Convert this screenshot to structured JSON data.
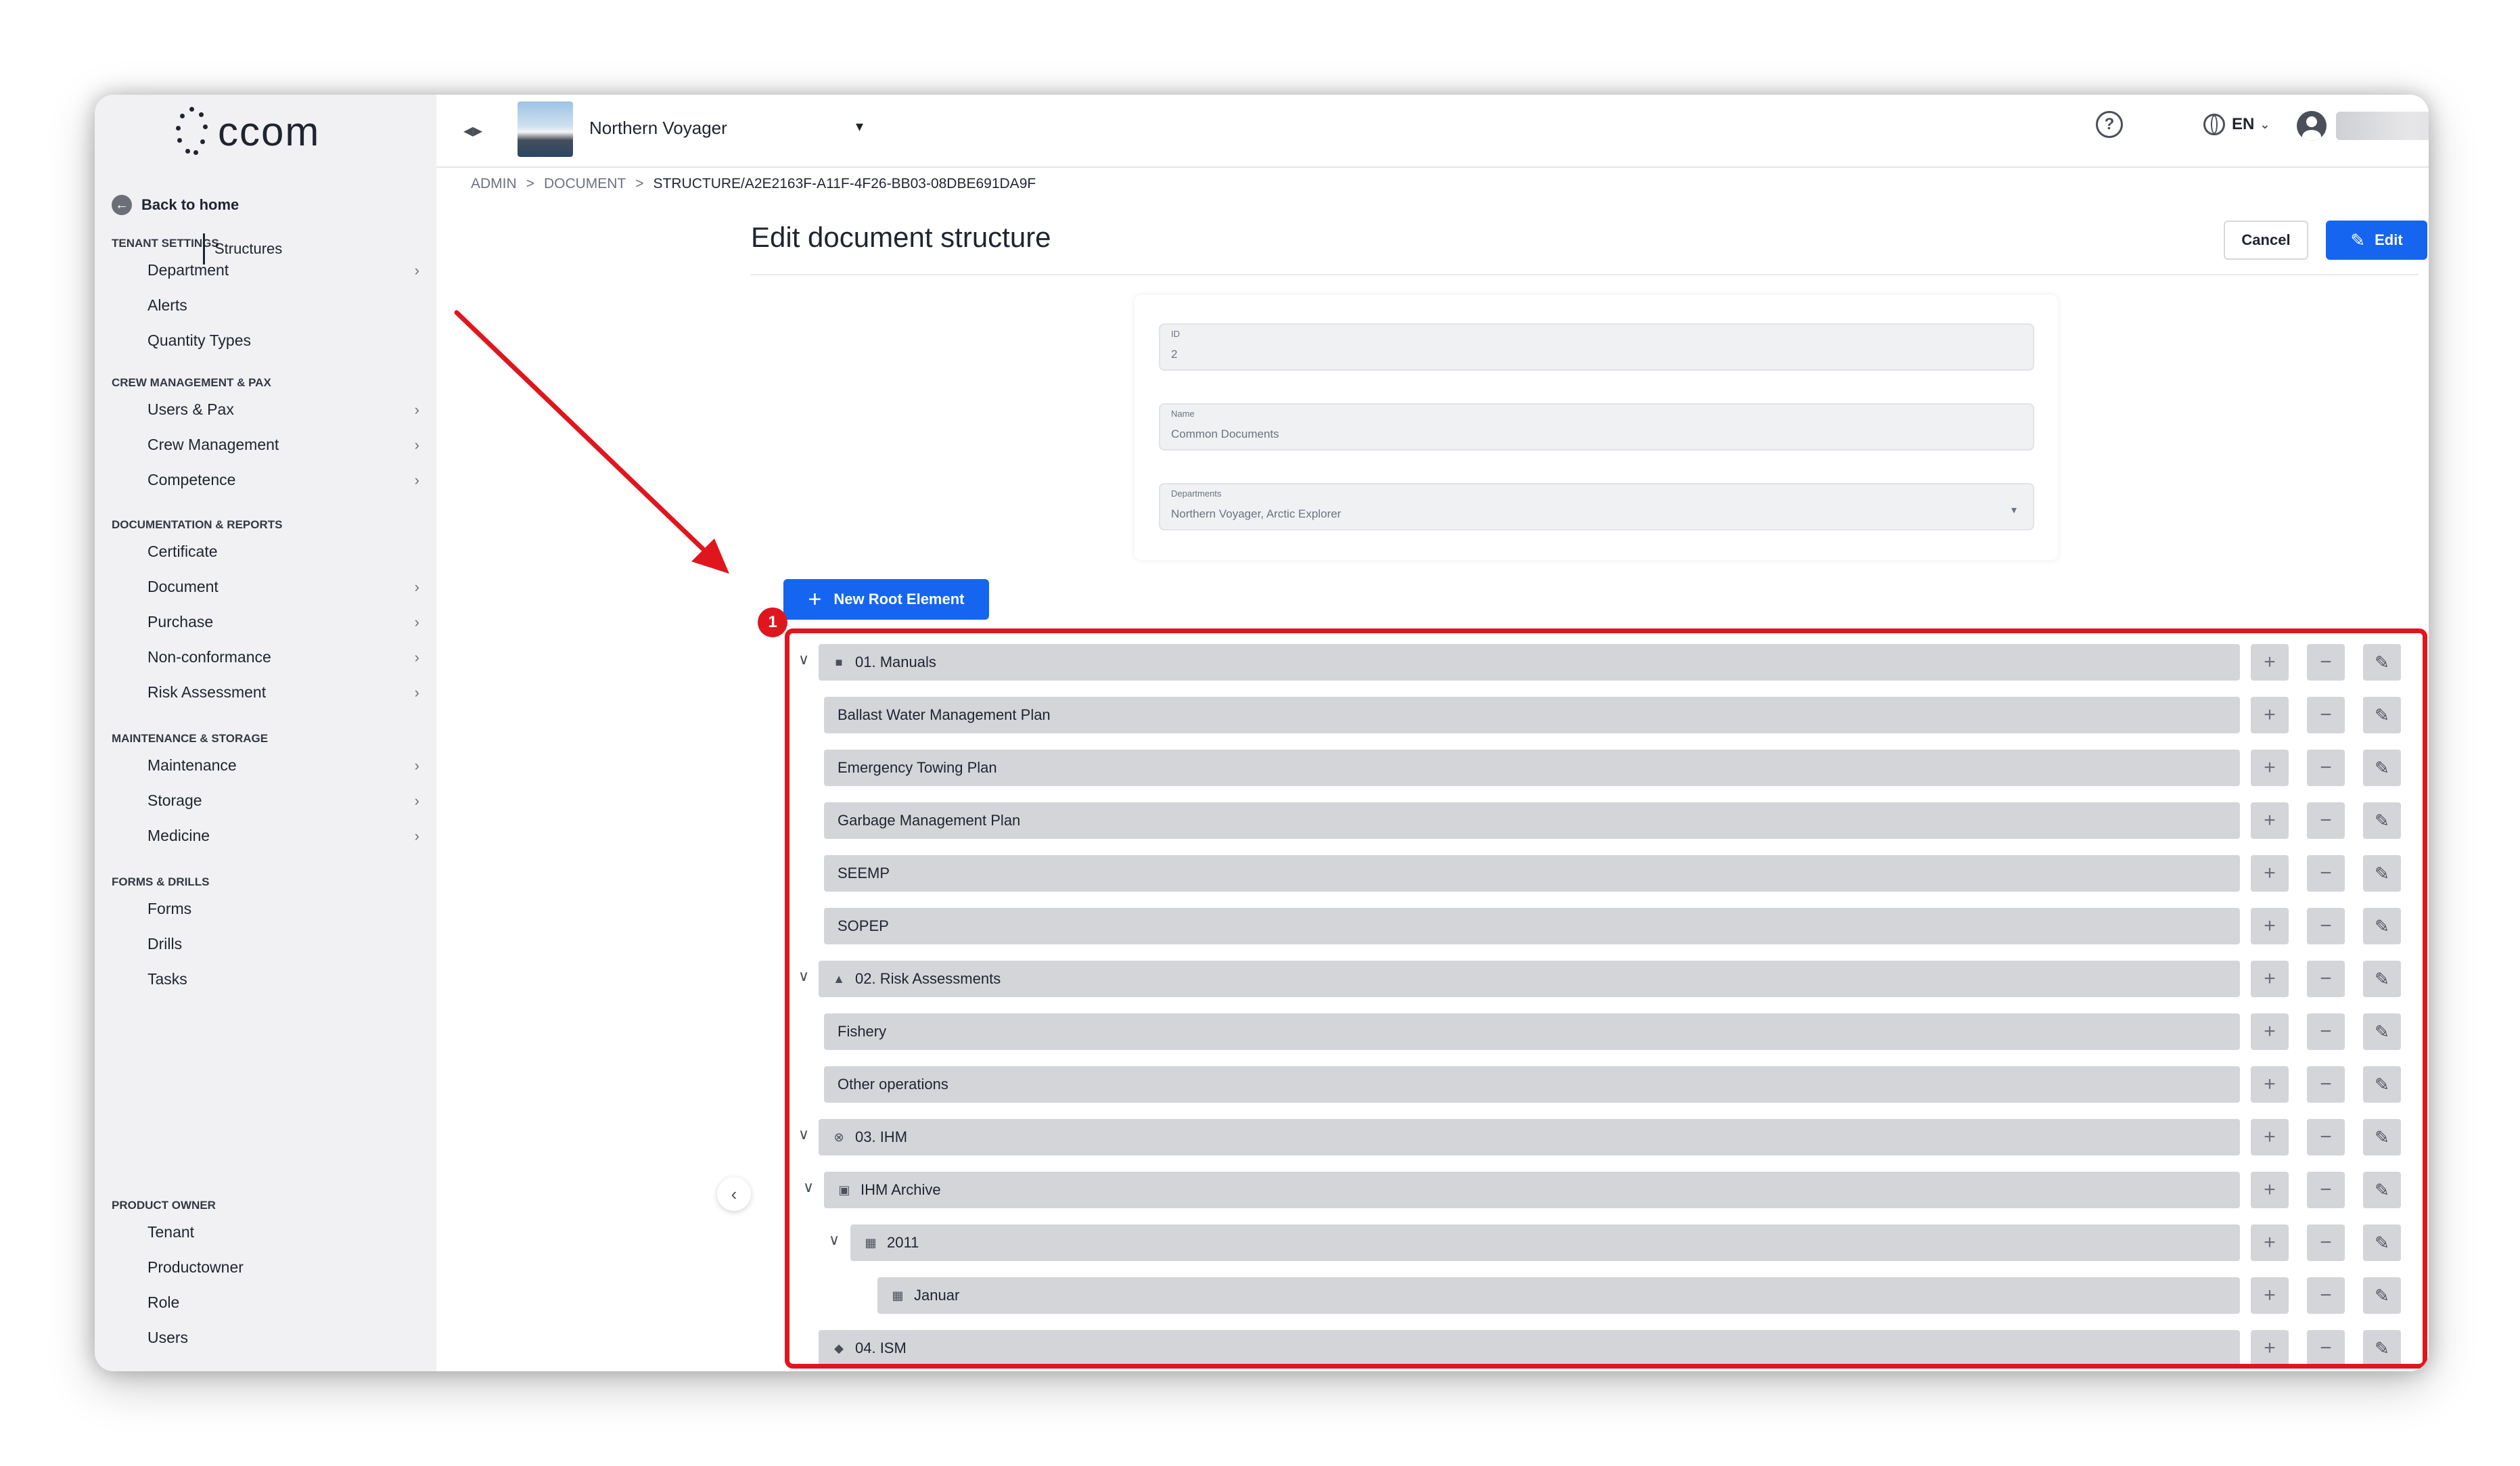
{
  "app": {
    "logo_text": "ccom",
    "vessel_name": "Northern Voyager"
  },
  "header": {
    "language": "EN"
  },
  "sidebar": {
    "back_home": "Back to home",
    "sections": [
      {
        "title": "TENANT SETTINGS",
        "items": [
          {
            "label": "Department",
            "chevron": true
          },
          {
            "label": "Alerts",
            "chevron": false
          },
          {
            "label": "Quantity Types",
            "chevron": false
          }
        ]
      },
      {
        "title": "CREW MANAGEMENT & PAX",
        "items": [
          {
            "label": "Users & Pax",
            "chevron": true
          },
          {
            "label": "Crew Management",
            "chevron": true
          },
          {
            "label": "Competence",
            "chevron": true
          }
        ]
      },
      {
        "title": "DOCUMENTATION & REPORTS",
        "items": [
          {
            "label": "Certificate",
            "chevron": false
          },
          {
            "label": "Document",
            "chevron": true
          },
          {
            "label": "Purchase",
            "chevron": true
          },
          {
            "label": "Non-conformance",
            "chevron": true
          },
          {
            "label": "Risk Assessment",
            "chevron": true
          }
        ]
      },
      {
        "title": "MAINTENANCE & STORAGE",
        "items": [
          {
            "label": "Maintenance",
            "chevron": true
          },
          {
            "label": "Storage",
            "chevron": true
          },
          {
            "label": "Medicine",
            "chevron": true
          }
        ]
      },
      {
        "title": "FORMS & DRILLS",
        "items": [
          {
            "label": "Forms",
            "chevron": false
          },
          {
            "label": "Drills",
            "chevron": false
          },
          {
            "label": "Tasks",
            "chevron": false
          }
        ]
      },
      {
        "title": "PRODUCT OWNER",
        "items": [
          {
            "label": "Tenant",
            "chevron": false
          },
          {
            "label": "Productowner",
            "chevron": false
          },
          {
            "label": "Role",
            "chevron": false
          },
          {
            "label": "Users",
            "chevron": false
          }
        ]
      }
    ]
  },
  "breadcrumb": {
    "items": [
      "ADMIN",
      "DOCUMENT",
      "STRUCTURE/A2E2163F-A11F-4F26-BB03-08DBE691DA9F"
    ],
    "separator": ">"
  },
  "structures_panel": {
    "item": "Structures"
  },
  "main": {
    "title": "Edit document structure",
    "cancel_label": "Cancel",
    "edit_label": "Edit",
    "new_root_label": "New Root Element",
    "badge": "1"
  },
  "form": {
    "fields": [
      {
        "label": "ID",
        "value": "2",
        "dropdown": false
      },
      {
        "label": "Name",
        "value": "Common Documents",
        "dropdown": false
      },
      {
        "label": "Departments",
        "value": "Northern Voyager, Arctic Explorer",
        "dropdown": true
      }
    ]
  },
  "tree": [
    {
      "label": "01. Manuals",
      "level": 0,
      "expandable": true,
      "icon": "book-icon"
    },
    {
      "label": "Ballast Water Management Plan",
      "level": 1,
      "expandable": false,
      "icon": ""
    },
    {
      "label": "Emergency Towing Plan",
      "level": 1,
      "expandable": false,
      "icon": ""
    },
    {
      "label": "Garbage Management Plan",
      "level": 1,
      "expandable": false,
      "icon": ""
    },
    {
      "label": "SEEMP",
      "level": 1,
      "expandable": false,
      "icon": ""
    },
    {
      "label": "SOPEP",
      "level": 1,
      "expandable": false,
      "icon": ""
    },
    {
      "label": "02. Risk Assessments",
      "level": 0,
      "expandable": true,
      "icon": "warning-icon"
    },
    {
      "label": "Fishery",
      "level": 1,
      "expandable": false,
      "icon": ""
    },
    {
      "label": "Other operations",
      "level": 1,
      "expandable": false,
      "icon": ""
    },
    {
      "label": "03. IHM",
      "level": 0,
      "expandable": true,
      "icon": "cancel-circle-icon"
    },
    {
      "label": "IHM Archive",
      "level": 1,
      "expandable": true,
      "icon": "archive-icon"
    },
    {
      "label": "2011",
      "level": 2,
      "expandable": true,
      "icon": "calendar-icon"
    },
    {
      "label": "Januar",
      "level": 3,
      "expandable": false,
      "icon": "calendar-icon"
    },
    {
      "label": "04. ISM",
      "level": 0,
      "expandable": false,
      "icon": "shield-icon"
    }
  ],
  "colors": {
    "primary": "#1565f0",
    "highlight": "#e0161e",
    "row_bg": "#d4d5d9",
    "sidebar_bg": "#f1f1f3"
  }
}
